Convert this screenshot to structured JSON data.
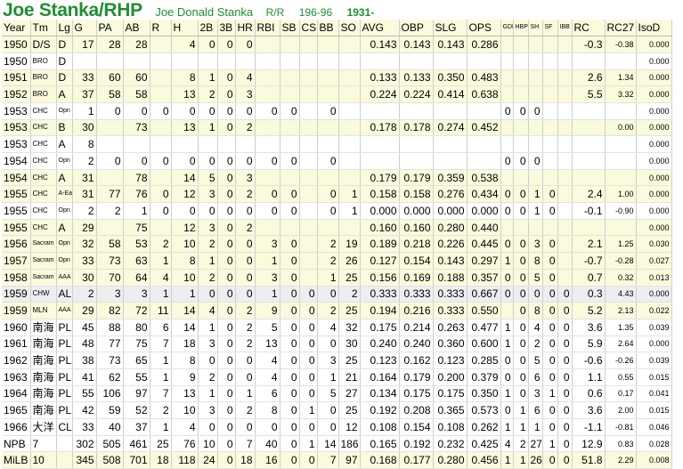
{
  "header": {
    "name": "Joe Stanka/RHP",
    "full_name": "Joe Donald Stanka",
    "bats_throws": "R/R",
    "height_weight": "196-96",
    "birth_year": "1931-"
  },
  "columns": [
    "Year",
    "Tm",
    "Lg",
    "G",
    "PA",
    "AB",
    "R",
    "H",
    "2B",
    "3B",
    "HR",
    "RBI",
    "SB",
    "CS",
    "BB",
    "SO",
    "AVG",
    "OBP",
    "SLG",
    "OPS",
    "GDP",
    "HBP",
    "SH",
    "SF",
    "IBB",
    "RC",
    "RC27",
    "IsoD"
  ],
  "rows": [
    {
      "style": "y",
      "cells": [
        "1950",
        "D/S",
        "D",
        "17",
        "28",
        "28",
        "",
        "4",
        "0",
        "0",
        "0",
        "",
        "",
        "",
        "",
        "",
        "0.143",
        "0.143",
        "0.143",
        "0.286",
        "",
        "",
        "",
        "",
        "",
        "-0.3",
        "-0.38",
        "0.000"
      ]
    },
    {
      "style": "w",
      "cells": [
        "1950",
        "BRO",
        "D",
        "",
        "",
        "",
        "",
        "",
        "",
        "",
        "",
        "",
        "",
        "",
        "",
        "",
        "",
        "",
        "",
        "",
        "",
        "",
        "",
        "",
        "",
        "",
        "",
        "0.000"
      ]
    },
    {
      "style": "y",
      "cells": [
        "1951",
        "BRO",
        "D",
        "33",
        "60",
        "60",
        "",
        "8",
        "1",
        "0",
        "4",
        "",
        "",
        "",
        "",
        "",
        "0.133",
        "0.133",
        "0.350",
        "0.483",
        "",
        "",
        "",
        "",
        "",
        "2.6",
        "1.34",
        "0.000"
      ]
    },
    {
      "style": "y",
      "cells": [
        "1952",
        "BRO",
        "A",
        "37",
        "58",
        "58",
        "",
        "13",
        "2",
        "0",
        "3",
        "",
        "",
        "",
        "",
        "",
        "0.224",
        "0.224",
        "0.414",
        "0.638",
        "",
        "",
        "",
        "",
        "",
        "5.5",
        "3.32",
        "0.000"
      ]
    },
    {
      "style": "w",
      "cells": [
        "1953",
        "CHC",
        "Opn",
        "1",
        "0",
        "0",
        "0",
        "0",
        "0",
        "0",
        "0",
        "0",
        "0",
        "",
        "0",
        "",
        "",
        "",
        "",
        "",
        "0",
        "0",
        "0",
        "",
        "",
        "",
        "",
        "0.000"
      ]
    },
    {
      "style": "y",
      "cells": [
        "1953",
        "CHC",
        "B",
        "30",
        "",
        "73",
        "",
        "13",
        "1",
        "0",
        "2",
        "",
        "",
        "",
        "",
        "",
        "0.178",
        "0.178",
        "0.274",
        "0.452",
        "",
        "",
        "",
        "",
        "",
        "",
        "0.00",
        "0.000"
      ]
    },
    {
      "style": "w",
      "cells": [
        "1953",
        "CHC",
        "A",
        "8",
        "",
        "",
        "",
        "",
        "",
        "",
        "",
        "",
        "",
        "",
        "",
        "",
        "",
        "",
        "",
        "",
        "",
        "",
        "",
        "",
        "",
        "",
        "",
        "0.000"
      ]
    },
    {
      "style": "w",
      "cells": [
        "1954",
        "CHC",
        "Opn",
        "2",
        "0",
        "0",
        "0",
        "0",
        "0",
        "0",
        "0",
        "0",
        "0",
        "",
        "0",
        "",
        "",
        "",
        "",
        "",
        "0",
        "0",
        "0",
        "",
        "",
        "",
        "",
        "0.000"
      ]
    },
    {
      "style": "y",
      "cells": [
        "1954",
        "CHC",
        "A",
        "31",
        "",
        "78",
        "",
        "14",
        "5",
        "0",
        "3",
        "",
        "",
        "",
        "",
        "",
        "0.179",
        "0.179",
        "0.359",
        "0.538",
        "",
        "",
        "",
        "",
        "",
        "",
        "",
        "0.000"
      ]
    },
    {
      "style": "y",
      "cells": [
        "1955",
        "CHC",
        "A-Ear",
        "31",
        "77",
        "76",
        "0",
        "12",
        "3",
        "0",
        "2",
        "0",
        "0",
        "",
        "0",
        "1",
        "0.158",
        "0.158",
        "0.276",
        "0.434",
        "0",
        "0",
        "1",
        "0",
        "",
        "2.4",
        "1.00",
        "0.000"
      ]
    },
    {
      "style": "w",
      "cells": [
        "1955",
        "CHC",
        "Opn",
        "2",
        "2",
        "1",
        "0",
        "0",
        "0",
        "0",
        "0",
        "0",
        "0",
        "",
        "0",
        "1",
        "0.000",
        "0.000",
        "0.000",
        "0.000",
        "0",
        "0",
        "1",
        "0",
        "",
        "-0.1",
        "-0.90",
        "0.000"
      ]
    },
    {
      "style": "y",
      "cells": [
        "1955",
        "CHC",
        "A",
        "29",
        "",
        "75",
        "",
        "12",
        "3",
        "0",
        "2",
        "",
        "",
        "",
        "",
        "",
        "0.160",
        "0.160",
        "0.280",
        "0.440",
        "",
        "",
        "",
        "",
        "",
        "",
        "",
        "0.000"
      ]
    },
    {
      "style": "y",
      "cells": [
        "1956",
        "Sacram",
        "Opn",
        "32",
        "58",
        "53",
        "2",
        "10",
        "2",
        "0",
        "0",
        "3",
        "0",
        "",
        "2",
        "19",
        "0.189",
        "0.218",
        "0.226",
        "0.445",
        "0",
        "0",
        "3",
        "0",
        "",
        "2.1",
        "1.25",
        "0.030"
      ]
    },
    {
      "style": "y",
      "cells": [
        "1957",
        "Sacram",
        "Opn",
        "33",
        "73",
        "63",
        "1",
        "8",
        "1",
        "0",
        "0",
        "1",
        "0",
        "",
        "2",
        "26",
        "0.127",
        "0.154",
        "0.143",
        "0.297",
        "1",
        "0",
        "8",
        "0",
        "",
        "-0.7",
        "-0.28",
        "0.027"
      ]
    },
    {
      "style": "y",
      "cells": [
        "1958",
        "Sacram",
        "AAA",
        "30",
        "70",
        "64",
        "4",
        "10",
        "2",
        "0",
        "0",
        "3",
        "0",
        "",
        "1",
        "25",
        "0.156",
        "0.169",
        "0.188",
        "0.357",
        "0",
        "0",
        "5",
        "0",
        "",
        "0.7",
        "0.32",
        "0.013"
      ]
    },
    {
      "style": "g",
      "cells": [
        "1959",
        "CHW",
        "AL",
        "2",
        "3",
        "3",
        "1",
        "1",
        "0",
        "0",
        "0",
        "1",
        "0",
        "0",
        "0",
        "2",
        "0.333",
        "0.333",
        "0.333",
        "0.667",
        "0",
        "0",
        "0",
        "0",
        "0",
        "0.3",
        "4.43",
        "0.000"
      ]
    },
    {
      "style": "y",
      "cells": [
        "1959",
        "MLN",
        "AAA",
        "29",
        "82",
        "72",
        "11",
        "14",
        "4",
        "0",
        "2",
        "9",
        "0",
        "0",
        "2",
        "25",
        "0.194",
        "0.216",
        "0.333",
        "0.550",
        "",
        "0",
        "8",
        "0",
        "0",
        "5.2",
        "2.13",
        "0.022"
      ]
    },
    {
      "style": "w",
      "cells": [
        "1960",
        "南海",
        "PL",
        "45",
        "88",
        "80",
        "6",
        "14",
        "1",
        "0",
        "2",
        "5",
        "0",
        "0",
        "4",
        "32",
        "0.175",
        "0.214",
        "0.263",
        "0.477",
        "1",
        "0",
        "4",
        "0",
        "0",
        "3.6",
        "1.35",
        "0.039"
      ]
    },
    {
      "style": "w",
      "cells": [
        "1961",
        "南海",
        "PL",
        "48",
        "77",
        "75",
        "7",
        "18",
        "3",
        "0",
        "2",
        "13",
        "0",
        "0",
        "0",
        "30",
        "0.240",
        "0.240",
        "0.360",
        "0.600",
        "1",
        "0",
        "2",
        "0",
        "0",
        "5.9",
        "2.64",
        "0.000"
      ]
    },
    {
      "style": "w",
      "cells": [
        "1962",
        "南海",
        "PL",
        "38",
        "73",
        "65",
        "1",
        "8",
        "0",
        "0",
        "0",
        "4",
        "0",
        "0",
        "3",
        "25",
        "0.123",
        "0.162",
        "0.123",
        "0.285",
        "0",
        "0",
        "5",
        "0",
        "0",
        "-0.6",
        "-0.26",
        "0.039"
      ]
    },
    {
      "style": "w",
      "cells": [
        "1963",
        "南海",
        "PL",
        "41",
        "62",
        "55",
        "1",
        "9",
        "2",
        "0",
        "0",
        "4",
        "0",
        "0",
        "1",
        "21",
        "0.164",
        "0.179",
        "0.200",
        "0.379",
        "0",
        "0",
        "6",
        "0",
        "0",
        "1.1",
        "0.55",
        "0.015"
      ]
    },
    {
      "style": "w",
      "cells": [
        "1964",
        "南海",
        "PL",
        "55",
        "106",
        "97",
        "7",
        "13",
        "1",
        "0",
        "1",
        "6",
        "0",
        "0",
        "5",
        "27",
        "0.134",
        "0.175",
        "0.175",
        "0.350",
        "1",
        "0",
        "3",
        "1",
        "0",
        "0.6",
        "0.17",
        "0.041"
      ]
    },
    {
      "style": "w",
      "cells": [
        "1965",
        "南海",
        "PL",
        "42",
        "59",
        "52",
        "2",
        "10",
        "3",
        "0",
        "2",
        "8",
        "0",
        "1",
        "0",
        "25",
        "0.192",
        "0.208",
        "0.365",
        "0.573",
        "0",
        "1",
        "6",
        "0",
        "0",
        "3.6",
        "2.00",
        "0.015"
      ]
    },
    {
      "style": "w",
      "cells": [
        "1966",
        "大洋",
        "CL",
        "33",
        "40",
        "37",
        "1",
        "4",
        "0",
        "0",
        "0",
        "0",
        "0",
        "0",
        "0",
        "12",
        "0.108",
        "0.154",
        "0.108",
        "0.262",
        "1",
        "1",
        "1",
        "0",
        "0",
        "-1.1",
        "-0.81",
        "0.046"
      ]
    },
    {
      "style": "tot",
      "cells": [
        "NPB",
        "7",
        "",
        "302",
        "505",
        "461",
        "25",
        "76",
        "10",
        "0",
        "7",
        "40",
        "0",
        "1",
        "14",
        "186",
        "0.165",
        "0.192",
        "0.232",
        "0.425",
        "4",
        "2",
        "27",
        "1",
        "0",
        "12.9",
        "0.83",
        "0.028"
      ]
    },
    {
      "style": "tot2",
      "cells": [
        "MiLB",
        "10",
        "",
        "345",
        "508",
        "701",
        "18",
        "118",
        "24",
        "0",
        "18",
        "16",
        "0",
        "0",
        "7",
        "97",
        "0.168",
        "0.177",
        "0.280",
        "0.456",
        "1",
        "1",
        "26",
        "0",
        "0",
        "51.8",
        "2.29",
        "0.008"
      ]
    }
  ]
}
